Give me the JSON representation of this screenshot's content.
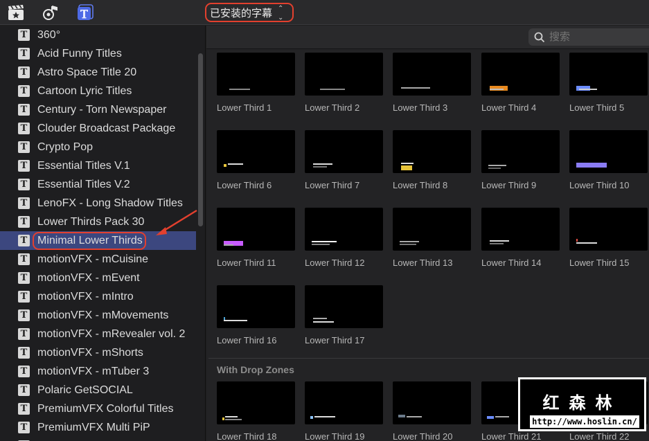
{
  "toolbar": {
    "icons": [
      "media-browser-icon",
      "audio-browser-icon",
      "titles-browser-icon"
    ],
    "browser_select": "已安装的字幕",
    "accent": "#e3402e"
  },
  "search": {
    "placeholder": "搜索"
  },
  "sidebar": {
    "items": [
      {
        "label": "360°"
      },
      {
        "label": "Acid Funny Titles"
      },
      {
        "label": "Astro Space Title 20"
      },
      {
        "label": "Cartoon Lyric Titles"
      },
      {
        "label": "Century - Torn Newspaper"
      },
      {
        "label": "Clouder Broadcast Package"
      },
      {
        "label": "Crypto Pop"
      },
      {
        "label": "Essential Titles V.1"
      },
      {
        "label": "Essential Titles V.2"
      },
      {
        "label": "LenoFX - Long Shadow Titles"
      },
      {
        "label": "Lower Thirds Pack 30"
      },
      {
        "label": "Minimal Lower Thirds",
        "selected": true
      },
      {
        "label": "motionVFX - mCuisine"
      },
      {
        "label": "motionVFX - mEvent"
      },
      {
        "label": "motionVFX - mIntro"
      },
      {
        "label": "motionVFX - mMovements"
      },
      {
        "label": "motionVFX - mRevealer vol. 2"
      },
      {
        "label": "motionVFX - mShorts"
      },
      {
        "label": "motionVFX - mTuber 3"
      },
      {
        "label": "Polaric GetSOCIAL"
      },
      {
        "label": "PremiumVFX Colorful Titles"
      },
      {
        "label": "PremiumVFX Multi PiP"
      },
      {
        "label": ""
      }
    ],
    "selected_color": "#3c477f"
  },
  "tiles": [
    {
      "label": "Lower Third 1"
    },
    {
      "label": "Lower Third 2"
    },
    {
      "label": "Lower Third 3"
    },
    {
      "label": "Lower Third 4"
    },
    {
      "label": "Lower Third 5"
    },
    {
      "label": "Lower Third 6"
    },
    {
      "label": "Lower Third 7"
    },
    {
      "label": "Lower Third 8"
    },
    {
      "label": "Lower Third 9"
    },
    {
      "label": "Lower Third 10"
    },
    {
      "label": "Lower Third 11"
    },
    {
      "label": "Lower Third 12"
    },
    {
      "label": "Lower Third 13"
    },
    {
      "label": "Lower Third 14"
    },
    {
      "label": "Lower Third 15"
    },
    {
      "label": "Lower Third 16"
    },
    {
      "label": "Lower Third 17"
    }
  ],
  "section_drop": {
    "title": "With Drop Zones",
    "tiles": [
      {
        "label": "Lower Third 18"
      },
      {
        "label": "Lower Third 19"
      },
      {
        "label": "Lower Third 20"
      },
      {
        "label": "Lower Third 21"
      },
      {
        "label": "Lower Third 22"
      }
    ]
  },
  "watermark": {
    "name": "红森林",
    "url": "http://www.hoslin.cn/"
  }
}
